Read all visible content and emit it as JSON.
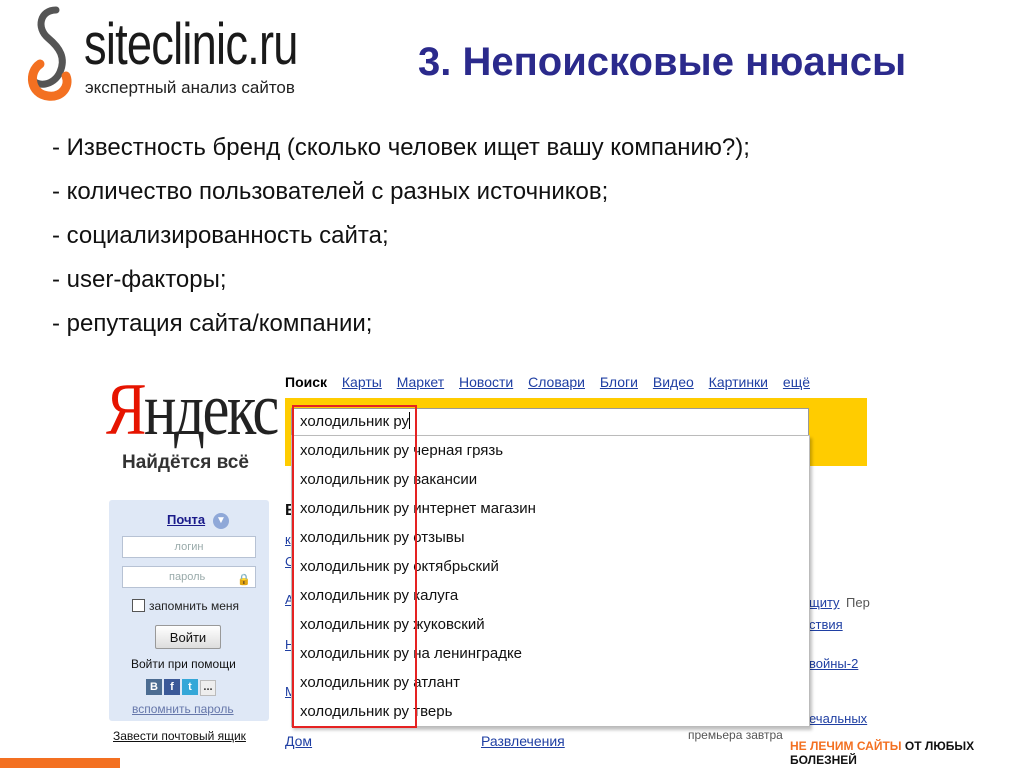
{
  "header": {
    "logo_text": "siteclinic.ru",
    "logo_sub": "экспертный анализ сайтов",
    "title": "3. Непоисковые нюансы"
  },
  "bullets": [
    "- Известность бренд (сколько человек ищет вашу компанию?);",
    "- количество пользователей с разных источников;",
    "- социализированность сайта;",
    "- user-факторы;",
    "- репутация сайта/компании;"
  ],
  "yandex": {
    "logo_first": "Я",
    "logo_rest": "ндекс",
    "slogan": "Найдётся всё",
    "nav": {
      "active": "Поиск",
      "links": [
        "Карты",
        "Маркет",
        "Новости",
        "Словари",
        "Блоги",
        "Видео",
        "Картинки",
        "ещё"
      ]
    },
    "search_query": "холодильник ру",
    "suggestions": [
      "холодильник ру черная грязь",
      "холодильник ру вакансии",
      "холодильник ру интернет магазин",
      "холодильник ру отзывы",
      "холодильник ру октябрьский",
      "холодильник ру калуга",
      "холодильник ру жуковский",
      "холодильник ру на ленинградке",
      "холодильник ру атлант",
      "холодильник ру тверь"
    ],
    "login": {
      "title": "Почта",
      "login_placeholder": "логин",
      "password_placeholder": "пароль",
      "remember": "запомнить меня",
      "button": "Войти",
      "via": "Войти при помощи",
      "socials": [
        "В",
        "f",
        "t",
        "..."
      ],
      "remind": "вспомнить пароль",
      "create": "Завести почтовый ящик"
    },
    "fragments": {
      "right_1": "щиту",
      "right_1b": "Пер",
      "right_2": "ствия",
      "right_3": "войны-2",
      "right_4": "ечальных",
      "premiere": "премьера завтра",
      "bottom_left": "Дом",
      "bottom_mid": "Развлечения"
    }
  },
  "footer": {
    "tagline_orange": "НЕ ЛЕЧИМ САЙТЫ",
    "tagline_rest": "ОТ ЛЮБЫХ БОЛЕЗНЕЙ"
  },
  "colors": {
    "title": "#2b2a8c",
    "accent_orange": "#f37021",
    "yandex_red": "#e61400",
    "search_yellow": "#ffcc00",
    "highlight_red": "#e52222"
  }
}
